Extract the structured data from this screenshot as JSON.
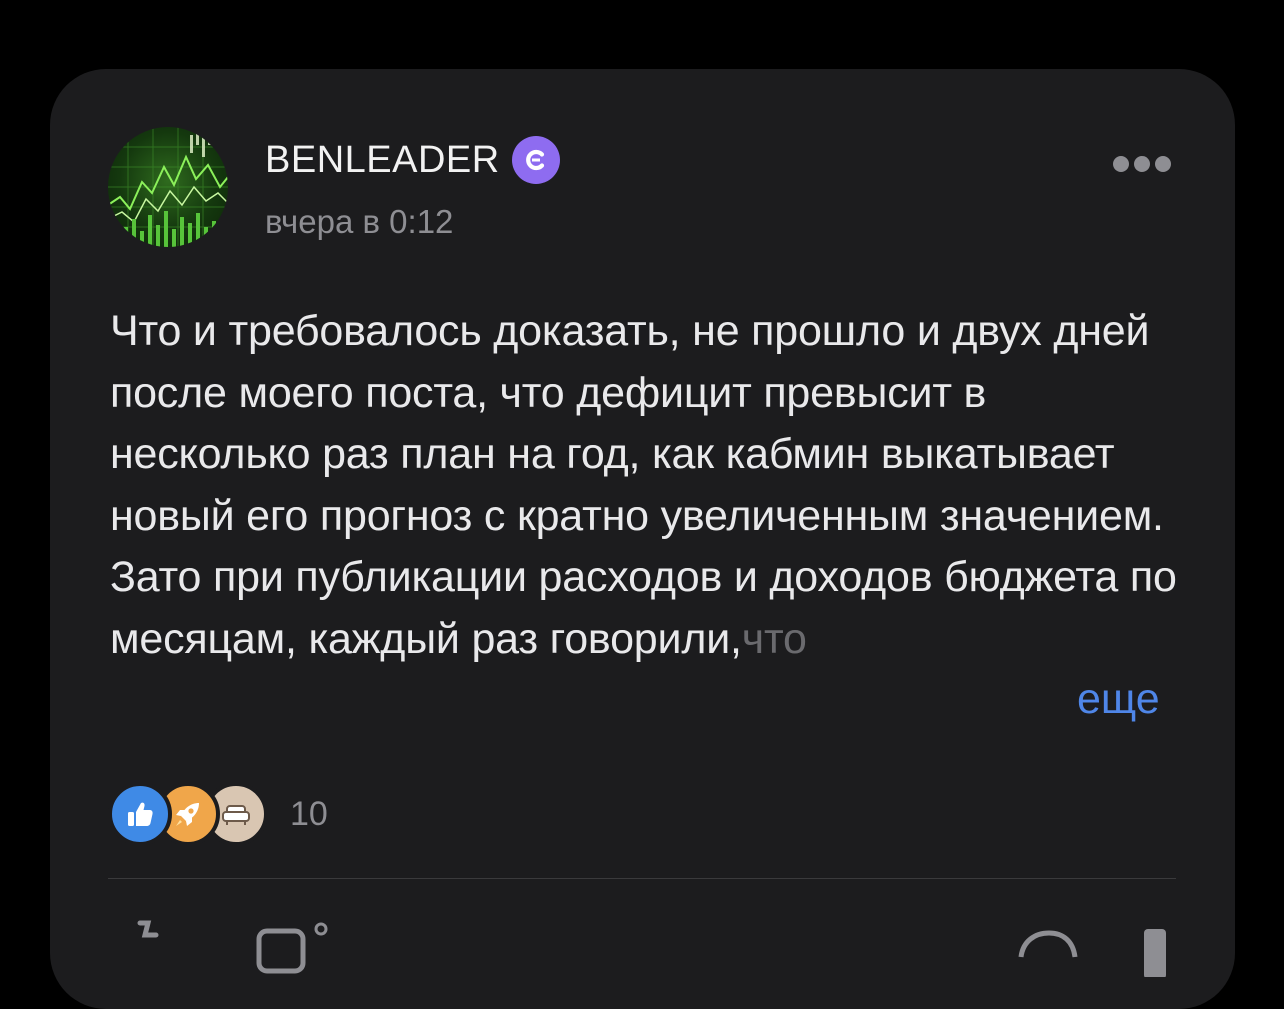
{
  "post": {
    "author": "BENLEADER",
    "verified_badge_letter": "C",
    "timestamp": "вчера в 0:12",
    "text_visible": "Что и требовалось доказать, не прошло и двух дней после моего поста, что дефицит превысит в несколько раз план на год, как кабмин выкатывает новый его прогноз с кратно увеличенным значением. Зато при публикации расходов и доходов бюджета по месяцам, каждый раз говорили,",
    "text_faded_tail": "что",
    "more_label": "еще",
    "reactions": {
      "count": "10",
      "icons": [
        "thumbs-up-icon",
        "rocket-icon",
        "sofa-icon"
      ]
    }
  },
  "colors": {
    "background": "#000000",
    "card": "#1c1c1e",
    "text_primary": "#e9e9eb",
    "text_secondary": "#8e8e93",
    "link": "#4f86e8",
    "badge": "#8e6cf0"
  },
  "actions": {
    "icons": [
      "like-action-icon",
      "comment-action-icon",
      "share-action-icon",
      "bookmark-action-icon"
    ]
  }
}
